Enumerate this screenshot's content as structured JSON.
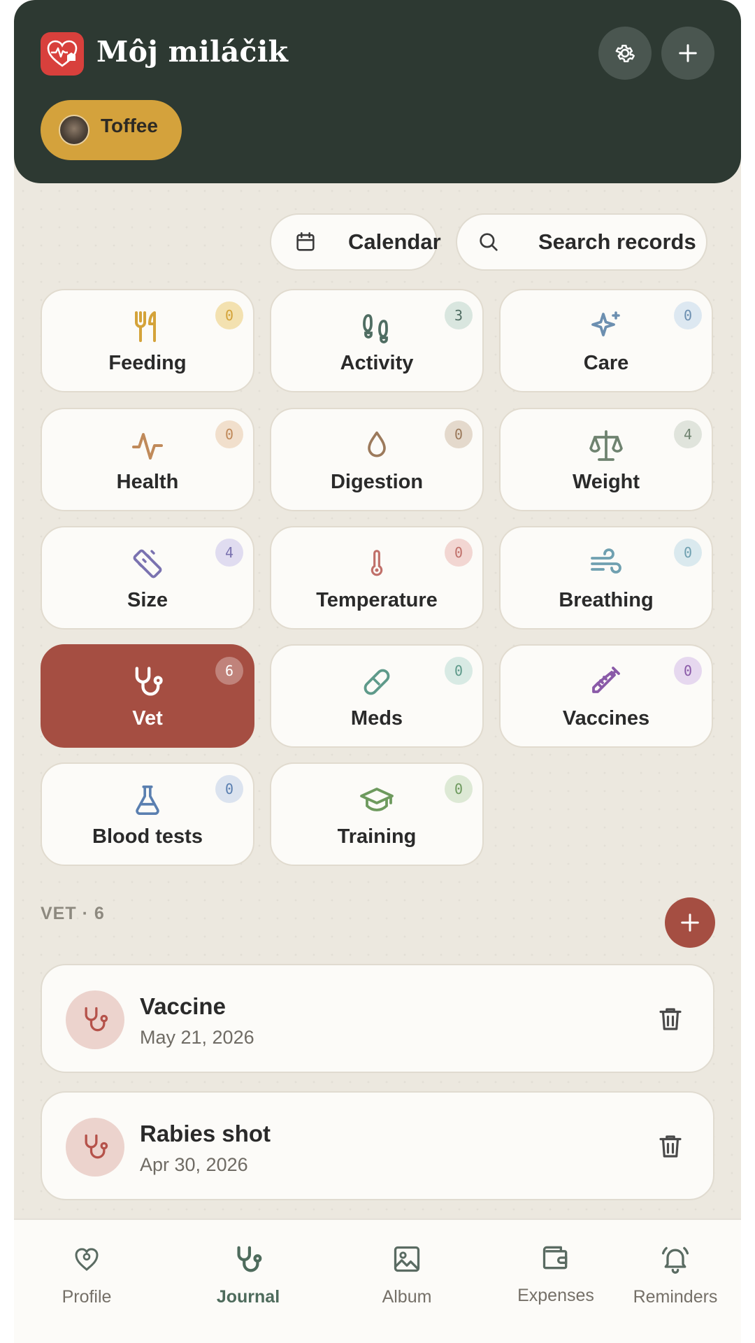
{
  "app": {
    "title": "Môj miláčik"
  },
  "header": {
    "pet_name": "Toffee"
  },
  "toolbar": {
    "calendar_label": "Calendar",
    "search_label": "Search records"
  },
  "categories": [
    {
      "label": "Feeding",
      "count": "0",
      "icon": "fork-knife-icon",
      "color": "#d4a33a",
      "badge_bg": "#f3e1b0",
      "active": false
    },
    {
      "label": "Activity",
      "count": "3",
      "icon": "footprints-icon",
      "color": "#4f6d62",
      "badge_bg": "#d9e6df",
      "active": false
    },
    {
      "label": "Care",
      "count": "0",
      "icon": "sparkle-icon",
      "color": "#6c8fb0",
      "badge_bg": "#dde8f1",
      "active": false
    },
    {
      "label": "Health",
      "count": "0",
      "icon": "pulse-icon",
      "color": "#c08a5a",
      "badge_bg": "#f1dfcc",
      "active": false
    },
    {
      "label": "Digestion",
      "count": "0",
      "icon": "droplet-icon",
      "color": "#9c7a5c",
      "badge_bg": "#e4d9cc",
      "active": false
    },
    {
      "label": "Weight",
      "count": "4",
      "icon": "scale-icon",
      "color": "#6f8370",
      "badge_bg": "#e0e4dc",
      "active": false
    },
    {
      "label": "Size",
      "count": "4",
      "icon": "ruler-icon",
      "color": "#7a72b0",
      "badge_bg": "#e0dcf0",
      "active": false
    },
    {
      "label": "Temperature",
      "count": "0",
      "icon": "thermometer-icon",
      "color": "#c0706a",
      "badge_bg": "#f2d6d2",
      "active": false
    },
    {
      "label": "Breathing",
      "count": "0",
      "icon": "wind-icon",
      "color": "#6fa0b0",
      "badge_bg": "#dae9ee",
      "active": false
    },
    {
      "label": "Vet",
      "count": "6",
      "icon": "stethoscope-icon",
      "color": "#ffffff",
      "badge_bg": "rgba(255,255,255,0.3)",
      "active": true
    },
    {
      "label": "Meds",
      "count": "0",
      "icon": "pill-icon",
      "color": "#5e9a8a",
      "badge_bg": "#d8eae4",
      "active": false
    },
    {
      "label": "Vaccines",
      "count": "0",
      "icon": "syringe-icon",
      "color": "#8a5aa8",
      "badge_bg": "#e6d8ef",
      "active": false
    },
    {
      "label": "Blood tests",
      "count": "0",
      "icon": "flask-icon",
      "color": "#5a7fb0",
      "badge_bg": "#dbe3ef",
      "active": false
    },
    {
      "label": "Training",
      "count": "0",
      "icon": "graduation-cap-icon",
      "color": "#6e9a5e",
      "badge_bg": "#dde9d5",
      "active": false
    }
  ],
  "section": {
    "title": "VET · 6"
  },
  "records": [
    {
      "title": "Vaccine",
      "date": "May 21, 2026"
    },
    {
      "title": "Rabies shot",
      "date": "Apr 30, 2026"
    }
  ],
  "nav": [
    {
      "label": "Profile",
      "icon": "heart-profile-icon",
      "active": false
    },
    {
      "label": "Journal",
      "icon": "stethoscope-icon",
      "active": true
    },
    {
      "label": "Album",
      "icon": "image-icon",
      "active": false
    },
    {
      "label": "Expenses",
      "icon": "wallet-icon",
      "active": false
    },
    {
      "label": "Reminders",
      "icon": "bell-icon",
      "active": false
    }
  ],
  "colors": {
    "header_bg": "#2d3932",
    "accent": "#a54e42",
    "logo": "#d8403c",
    "pet_chip": "#d4a23c",
    "background": "#ece8df"
  }
}
